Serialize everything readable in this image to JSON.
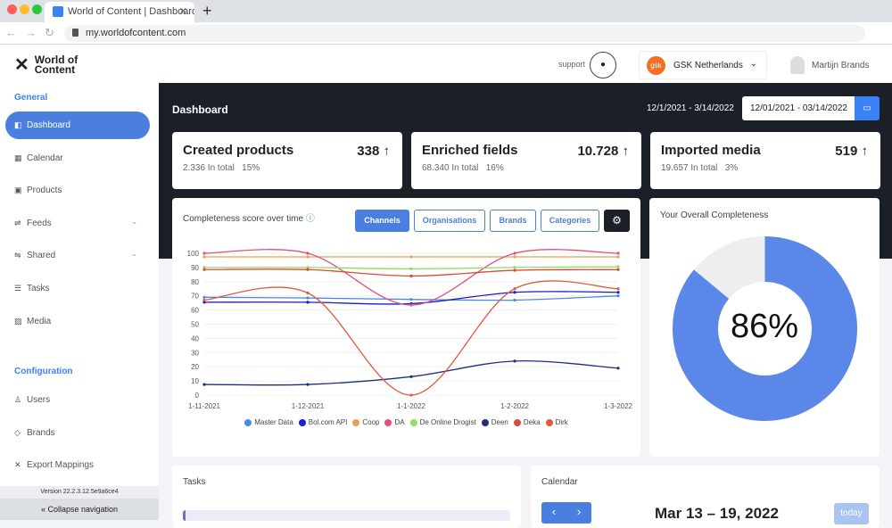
{
  "browser": {
    "tab_title": "World of Content | Dashboard",
    "url": "my.worldofcontent.com"
  },
  "header": {
    "logo_line1": "World of",
    "logo_line2": "Content",
    "support_label": "support",
    "org_logo": "gsk",
    "org_name": "GSK Netherlands",
    "user_name": "Martijn Brands"
  },
  "sidebar": {
    "general_label": "General",
    "items": [
      {
        "label": "Dashboard",
        "icon": "dashboard-icon"
      },
      {
        "label": "Calendar",
        "icon": "calendar-icon"
      },
      {
        "label": "Products",
        "icon": "box-icon"
      },
      {
        "label": "Feeds",
        "icon": "feed-icon"
      },
      {
        "label": "Shared",
        "icon": "share-icon"
      },
      {
        "label": "Tasks",
        "icon": "tasks-icon"
      },
      {
        "label": "Media",
        "icon": "image-icon"
      }
    ],
    "config_label": "Configuration",
    "config_items": [
      {
        "label": "Users",
        "icon": "user-icon"
      },
      {
        "label": "Brands",
        "icon": "tag-icon"
      },
      {
        "label": "Export Mappings",
        "icon": "export-icon"
      }
    ],
    "version": "Version 22.2.3.12.5e9a6ce4",
    "collapse_label": "Collapse navigation"
  },
  "main": {
    "title": "Dashboard",
    "date_range_text": "12/1/2021 - 3/14/2022",
    "date_input_value": "12/01/2021 - 03/14/2022",
    "stats": [
      {
        "label": "Created products",
        "value": "338",
        "total": "2.336 In total",
        "pct": "15%"
      },
      {
        "label": "Enriched fields",
        "value": "10.728",
        "total": "68.340 In total",
        "pct": "16%"
      },
      {
        "label": "Imported media",
        "value": "519",
        "total": "19.657 In total",
        "pct": "3%"
      }
    ],
    "chart_title": "Completeness score over time",
    "tabs": [
      "Channels",
      "Organisations",
      "Brands",
      "Categories"
    ],
    "completeness_title": "Your Overall Completeness",
    "completeness_pct": "86%",
    "completeness_value": 86,
    "tasks_title": "Tasks",
    "calendar_title": "Calendar",
    "calendar_range": "Mar 13 – 19, 2022",
    "today_label": "today",
    "prev": "‹",
    "next": "›"
  },
  "chart_data": {
    "type": "line",
    "x": [
      "1-11-2021",
      "1-12-2021",
      "1-1-2022",
      "1-2-2022",
      "1-3-2022"
    ],
    "ylim": [
      0,
      100
    ],
    "yticks": [
      0,
      10,
      20,
      30,
      40,
      50,
      60,
      70,
      80,
      90,
      100
    ],
    "legend_position": "bottom",
    "series": [
      {
        "name": "Master Data",
        "color": "#4a8ae8",
        "values": [
          69,
          68.5,
          67.5,
          67,
          70
        ]
      },
      {
        "name": "Bol.com API",
        "color": "#1a1adb",
        "values": [
          65.5,
          65.5,
          64.5,
          72.5,
          72.5
        ]
      },
      {
        "name": "Coop",
        "color": "#e8a050",
        "values": [
          97.5,
          97.5,
          97.5,
          97.5,
          97.5
        ]
      },
      {
        "name": "DA",
        "color": "#e0507a",
        "values": [
          100,
          100,
          63.5,
          100,
          100
        ]
      },
      {
        "name": "De Online Drogist",
        "color": "#90dd60",
        "values": [
          90,
          90,
          89,
          90,
          90.5
        ]
      },
      {
        "name": "Deen",
        "color": "#1e2f78",
        "values": [
          7.5,
          7.5,
          13,
          24,
          19
        ]
      },
      {
        "name": "Deka",
        "color": "#d84a3a",
        "values": [
          88.5,
          88.5,
          84,
          88,
          88.5
        ]
      },
      {
        "name": "Dirk",
        "color": "#e05a40",
        "values": [
          67,
          72,
          0,
          75,
          75
        ]
      }
    ]
  }
}
